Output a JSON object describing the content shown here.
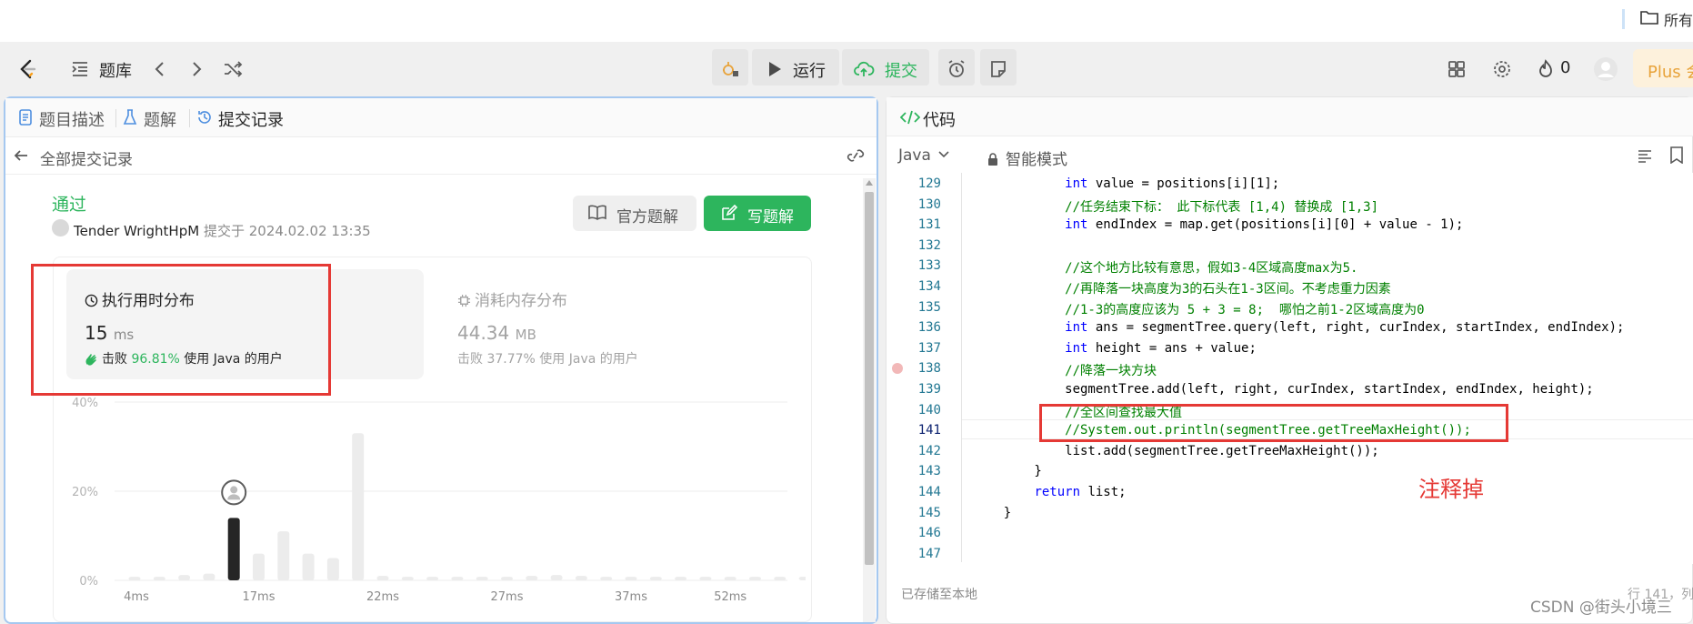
{
  "browser": {
    "folder_label": "所有"
  },
  "header": {
    "problem_bank": "题库",
    "run_label": "运行",
    "submit_label": "提交",
    "streak_count": "0",
    "plus_label": "Plus 会"
  },
  "left_panel": {
    "tabs": [
      {
        "label": "题目描述",
        "icon": "doc-icon"
      },
      {
        "label": "题解",
        "icon": "flask-icon"
      },
      {
        "label": "提交记录",
        "icon": "history-icon"
      }
    ],
    "back_label": "全部提交记录",
    "status": "通过",
    "author": "Tender WrightHpM",
    "submitted_text": "提交于 2024.02.02 13:35",
    "official_solution_label": "官方题解",
    "write_solution_label": "写题解",
    "runtime": {
      "title": "执行用时分布",
      "value": "15",
      "unit": "ms",
      "beats_prefix": "击败",
      "beats_pct": "96.81%",
      "beats_suffix": "使用 Java 的用户"
    },
    "memory": {
      "title": "消耗内存分布",
      "value": "44.34",
      "unit": "MB",
      "beats_text": "击败 37.77% 使用 Java 的用户"
    }
  },
  "chart_data": {
    "type": "bar",
    "x_tick_labels": [
      "4ms",
      "17ms",
      "22ms",
      "27ms",
      "37ms",
      "52ms"
    ],
    "y_tick_labels": [
      "0%",
      "20%",
      "40%"
    ],
    "ylim": [
      0,
      40
    ],
    "highlight_index": 4,
    "values": [
      0.8,
      0.8,
      1.2,
      1.5,
      14,
      6,
      11,
      6,
      5,
      33,
      1,
      0.8,
      0.8,
      0.8,
      0.8,
      0.8,
      1,
      1.2,
      1,
      0.8,
      0.8,
      0.8,
      0.8,
      0.8,
      0.8,
      0.8,
      0.8,
      0.8
    ],
    "grid": true,
    "highlight_color": "#262626",
    "bar_color": "#ececec"
  },
  "right_panel": {
    "tab_label": "代码",
    "language": "Java",
    "mode": "智能模式",
    "saved_text": "已存储至本地",
    "cursor_text": "行 141，列",
    "annotation": "注释掉",
    "code_lines": [
      {
        "n": "129",
        "text": "            int value = positions[i][1];"
      },
      {
        "n": "130",
        "text": "            //任务结束下标： 此下标代表 [1,4) 替换成 [1,3]"
      },
      {
        "n": "131",
        "text": "            int endIndex = map.get(positions[i][0] + value - 1);"
      },
      {
        "n": "132",
        "text": ""
      },
      {
        "n": "133",
        "text": "            //这个地方比较有意思，假如3-4区域高度max为5."
      },
      {
        "n": "134",
        "text": "            //再降落一块高度为3的石头在1-3区间。不考虑重力因素"
      },
      {
        "n": "135",
        "text": "            //1-3的高度应该为 5 + 3 = 8;  哪怕之前1-2区域高度为0"
      },
      {
        "n": "136",
        "text": "            int ans = segmentTree.query(left, right, curIndex, startIndex, endIndex);"
      },
      {
        "n": "137",
        "text": "            int height = ans + value;"
      },
      {
        "n": "138",
        "text": "            //降落一块方块"
      },
      {
        "n": "139",
        "text": "            segmentTree.add(left, right, curIndex, startIndex, endIndex, height);"
      },
      {
        "n": "140",
        "text": "            //全区间查找最大值"
      },
      {
        "n": "141",
        "text": "            //System.out.println(segmentTree.getTreeMaxHeight());"
      },
      {
        "n": "142",
        "text": "            list.add(segmentTree.getTreeMaxHeight());"
      },
      {
        "n": "143",
        "text": "        }"
      },
      {
        "n": "144",
        "text": "        return list;"
      },
      {
        "n": "145",
        "text": "    }"
      },
      {
        "n": "146",
        "text": ""
      },
      {
        "n": "147",
        "text": ""
      }
    ]
  },
  "watermark": "CSDN @街头小境三"
}
